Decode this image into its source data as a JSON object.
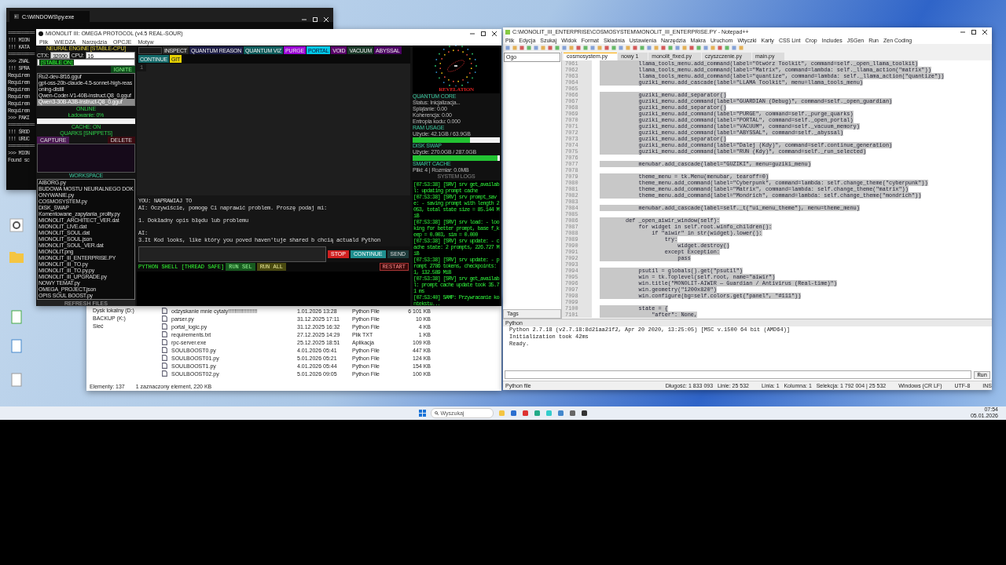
{
  "console": {
    "title": "C:\\WINDOWS\\py.exe",
    "lines": [
      "==========",
      "!!! MION",
      "!!! KATA",
      "==========",
      ">>> ZNAL",
      "!!! SPRA",
      "Requirem",
      "Requirem",
      "Requirem",
      "Requirem",
      "Requirem",
      "Requirem",
      ">>> PAKI",
      "==========",
      "!!! ŚROD",
      "!!! URUC",
      "==========",
      ">>> MION",
      "Found sc"
    ]
  },
  "app": {
    "title": "MIONOLIT III: OMEGA PROTOCOL (v4.5 REAL-SOUR)",
    "menu": [
      "Plik",
      "WIEDZA",
      "Narzędzia",
      "OPCJE",
      "Motyw"
    ],
    "engine": {
      "heading": "NEURAL ENGINE [STABLE-CPU]",
      "ctx_label": "CTX:",
      "ctx_value": "32000",
      "cpu_label": "CPU:",
      "cpu_value": "16",
      "mode_value": "[STABLE ON]",
      "ignite": "IGNITE",
      "models": [
        {
          "name": "Ru2-dev-8f16.gguf",
          "selected": false
        },
        {
          "name": "gpt-oss-20b-claude-4.5-sonnet-high-reasoning-distill",
          "selected": false
        },
        {
          "name": "Qwen-Coder-V1-40B-instruct.Q8_0.gguf",
          "selected": false
        },
        {
          "name": "Qwen3-30B-A3B-Instruct-Q8_0.gguf",
          "selected": true
        }
      ],
      "status": "ONLINE",
      "loading": "Ładowanie: 0%",
      "level": 0,
      "cache": "CACHE: ON"
    },
    "quarks": {
      "heading": "QUARKS [SNIPPETS]",
      "capture": "CAPTURE",
      "delete": "DELETE"
    },
    "workspace": {
      "heading": "WORKSPACE",
      "files": [
        "AIBORG.py",
        "BUDOWA MOSTU NEURALNEGO DOKONYWANIE.py",
        "COSMOSYSTEM.py",
        "DISK_SWAP",
        "Komentowane_zapytania_prolity.py",
        "MIONOLIT_ARCHITECT_VER.dat",
        "MIONOLIT_LIVE.dat",
        "MIONOLIT_SOUL.dat",
        "MIONOLIT_SOUL.json",
        "MIONOLIT_SOUL_VER.dat",
        "MIONOLIT.png",
        "MIONOLIT_III_ENTERPRISE.PY",
        "MIONOLIT_III_TO.py",
        "MIONOLIT_III_TO.py.py",
        "MIONOLIT_III_UPGRADE.py",
        "NOWY TEMAT.py",
        "OMEGA_PROJECT.json",
        "OPIS SOUL BOOST.py"
      ],
      "refresh": "REFRESH FILES"
    },
    "toolbar": [
      {
        "label": "INSPECT",
        "color": "#2b2b2b"
      },
      {
        "label": "QUANTUM REASON",
        "color": "#1e1e46"
      },
      {
        "label": "QUANTUM VIZ",
        "color": "#0f5c5c"
      },
      {
        "label": "PURGE",
        "color": "#9b00d6"
      },
      {
        "label": "PORTAL",
        "color": "#00c8e8"
      },
      {
        "label": "VOID",
        "color": "#5a006a"
      },
      {
        "label": "VACUUM",
        "color": "#1c3a2a"
      },
      {
        "label": "ABYSSAL",
        "color": "#4a0060"
      },
      {
        "label": "CONTINUE",
        "color": "#136a6a"
      },
      {
        "label": "GIT",
        "color": "#e6d200"
      }
    ],
    "editor": {
      "line_number": "1"
    },
    "chat": [
      [
        "YOU: NAPRAWIAJ TO",
        "AI: Oczywiście, pomogę Ci naprawić problem. Proszę podaj mi:"
      ],
      [
        "1. Dokładny opis błędu lub problemu"
      ],
      [
        "AI:",
        "3.It Kod looks, like który you poved haven'tuje shared b chcią actuald Python"
      ]
    ],
    "chat_buttons": {
      "stop": "STOP",
      "continue": "CONTINUE",
      "send": "SEND"
    },
    "shell": {
      "title": "PYTHON SHELL [THREAD SAFE]",
      "run_sel": "RUN SEL",
      "run_all": "RUN ALL",
      "restart": "RESTART"
    },
    "monitor": {
      "title": "REVELATION",
      "core_title": "QUANTUM CORE",
      "core_lines": [
        "Status: Inicjalizacja...",
        "Splątanie: 0.00",
        "Koherencja: 0.00",
        "Entropia kodu: 0.000"
      ],
      "meters": [
        {
          "title": "RAM USAGE",
          "reading": "Użycie: 42.1GB / 63.9GB",
          "level": 0.66
        },
        {
          "title": "DISK SWAP",
          "reading": "Użycie: 270.0GB / 287.0GB",
          "level": 0.97
        }
      ],
      "cache_title": "SMART CACHE",
      "cache_line": "Pliki: 4 | Rozmiar: 0.0MB",
      "logs_title": "SYSTEM LOGS",
      "logs": [
        "[07:53:38] [SRV] srv get_availabl: updating prompt cache",
        "[07:53:38] [SRV] srv prompt_save: - saving prompt with length 2053, total state size = 85.144 MiB",
        "[07:53:38] [SRV] srv load: - looking for better prompt, base f_keep = 0.003, sim = 0.000",
        "[07:53:38] [SRV] srv update: - cache state: 2 prompts, 226.727 MiB",
        "[07:53:38] [SRV] srv update: - prompt 2786 tokens, checkpoints: 1, 132.589 MiB",
        "[07:53:38] [SRV] srv get_availabl: prompt cache update took 35.71 ms",
        "[07:53:40] SAMP: Przywracanie kontekstu..."
      ]
    }
  },
  "explorer": {
    "tree": [
      "Dysk lokalny (D:)",
      "BACKUP (K:)",
      "Sieć"
    ],
    "rows": [
      {
        "name": "odzyskanie mnie cytaty!!!!!!!!!!!!!!!!!!!",
        "date": "1.01.2026 13:28",
        "type": "Python File",
        "size": "6 101 KB"
      },
      {
        "name": "parser.py",
        "date": "31.12.2025 17:11",
        "type": "Python File",
        "size": "10 KB"
      },
      {
        "name": "portal_logic.py",
        "date": "31.12.2025 16:32",
        "type": "Python File",
        "size": "4 KB"
      },
      {
        "name": "requirements.txt",
        "date": "27.12.2025 14:29",
        "type": "Plik TXT",
        "size": "1 KB"
      },
      {
        "name": "rpc-server.exe",
        "date": "25.12.2025 18:51",
        "type": "Aplikacja",
        "size": "109 KB"
      },
      {
        "name": "SOULBOOST0.py",
        "date": "4.01.2026 05:41",
        "type": "Python File",
        "size": "447 KB"
      },
      {
        "name": "SOULBOOST01.py",
        "date": "5.01.2026 05:21",
        "type": "Python File",
        "size": "124 KB"
      },
      {
        "name": "SOULBOOST1.py",
        "date": "4.01.2026 05:44",
        "type": "Python File",
        "size": "154 KB"
      },
      {
        "name": "SOULBOOST02.py",
        "date": "5.01.2026 09:05",
        "type": "Python File",
        "size": "100 KB"
      }
    ],
    "status": [
      "Elementy: 137",
      "1 zaznaczony element, 220 KB"
    ]
  },
  "notepad": {
    "title": "C:\\MONOLIT_III_ENTERPRISE\\COSMOSYSTEM\\MONOLIT_III_ENTERPRISE.PY - Notepad++",
    "menu": [
      "Plik",
      "Edycja",
      "Szukaj",
      "Widok",
      "Format",
      "Składnia",
      "Ustawienia",
      "Narzędzia",
      "Makra",
      "Uruchom",
      "Wtyczki",
      "Karty",
      "CSS Lint",
      "Crop",
      "Includes",
      "JSGen",
      "Run",
      "Zen Coding"
    ],
    "tabs": [
      {
        "label": "cosmosystem.py",
        "selected": true
      },
      {
        "label": "nowy 1",
        "selected": false
      },
      {
        "label": "monolit_fixed.py",
        "selected": false
      },
      {
        "label": "czyszczenie.py",
        "selected": false
      },
      {
        "label": "main.py",
        "selected": false
      }
    ],
    "search_value": "Ogo",
    "code": [
      {
        "n": "7061",
        "text": "            llama_tools_menu.add_command(label=\"Otwórz Toolkit\", command=self._open_llama_toolkit)"
      },
      {
        "n": "7062",
        "text": "            llama_tools_menu.add_command(label=\"Matrix\", command=lambda: self._llama_action(\"matrix\"))"
      },
      {
        "n": "7063",
        "text": "            llama_tools_menu.add_command(label=\"quantize\", command=lambda: self._llama_action(\"quantize\"))"
      },
      {
        "n": "7064",
        "text": "            guziki_menu.add_cascade(label=\"LLAMA Toolkit\", menu=llama_tools_menu)"
      },
      {
        "n": "7065"
      },
      {
        "n": "7066",
        "text": "            guziki_menu.add_separator()"
      },
      {
        "n": "7067",
        "text": "            guziki_menu.add_command(label=\"GUARDIAN (Debug)\", command=self._open_guardian)"
      },
      {
        "n": "7068",
        "text": "            guziki_menu.add_separator()"
      },
      {
        "n": "7069",
        "text": "            guziki_menu.add_command(label=\"PURGE\", command=self._purge_quarks)"
      },
      {
        "n": "7070",
        "text": "            guziki_menu.add_command(label=\"PORTAL\", command=self._open_portal)"
      },
      {
        "n": "7071",
        "text": "            guziki_menu.add_command(label=\"VACUUM\", command=self._vacuum_memory)"
      },
      {
        "n": "7072",
        "text": "            guziki_menu.add_command(label=\"ABYSSAL\", command=self._abyssal)"
      },
      {
        "n": "7073",
        "text": "            guziki_menu.add_separator()"
      },
      {
        "n": "7074",
        "text": "            guziki_menu.add_command(label=\"Dalej (Kdy)\", command=self.continue_generation)"
      },
      {
        "n": "7075",
        "text": "            guziki_menu.add_command(label=\"RUN (Kdy)\", command=self._run_selected)"
      },
      {
        "n": "7076"
      },
      {
        "n": "7077",
        "text": "            menubar.add_cascade(label=\"GUZIKI\", menu=guziki_menu)"
      },
      {
        "n": "7078"
      },
      {
        "n": "7079",
        "text": "            theme_menu = tk.Menu(menubar, tearoff=0)"
      },
      {
        "n": "7080",
        "text": "            theme_menu.add_command(label=\"Cyberpunk\", command=lambda: self.change_theme(\"cyberpunk\"))"
      },
      {
        "n": "7081",
        "text": "            theme_menu.add_command(label=\"Matrix\", command=lambda: self.change_theme(\"matrix\"))"
      },
      {
        "n": "7082",
        "text": "            theme_menu.add_command(label=\"Mondrich\", command=lambda: self.change_theme(\"mondrich\"))"
      },
      {
        "n": "7083"
      },
      {
        "n": "7084",
        "text": "            menubar.add_cascade(label=self._t(\"ui_menu_theme\"), menu=theme_menu)"
      },
      {
        "n": "7085"
      },
      {
        "n": "7086",
        "text": "        def _open_aiwir_window(self):"
      },
      {
        "n": "7087",
        "text": "            for widget in self.root.winfo_children():"
      },
      {
        "n": "7088",
        "text": "                if \"aiwir\" in str(widget).lower():"
      },
      {
        "n": "7089",
        "text": "                    try:"
      },
      {
        "n": "7090",
        "text": "                        widget.destroy()"
      },
      {
        "n": "7091",
        "text": "                    except Exception:"
      },
      {
        "n": "7092",
        "text": "                        pass"
      },
      {
        "n": "7093"
      },
      {
        "n": "7094",
        "text": "            psutil = globals().get(\"psutil\")"
      },
      {
        "n": "7095",
        "text": "            win = tk.Toplevel(self.root, name=\"aiwir\")"
      },
      {
        "n": "7096",
        "text": "            win.title(\"MONOLIT-AIWIR — Guardian / Antivirus (Real-time)\")"
      },
      {
        "n": "7097",
        "text": "            win.geometry(\"1200x820\")"
      },
      {
        "n": "7098",
        "text": "            win.configure(bg=self.colors.get(\"panel\", \"#111\"))"
      },
      {
        "n": "7099"
      },
      {
        "n": "7100",
        "text": "            state = {"
      },
      {
        "n": "7101",
        "text": "                \"after\": None,"
      }
    ],
    "panel_tab": "Tags",
    "console_title": "Python",
    "console_lines": [
      "Python 2.7.18 (v2.7.18:8d21aa21f2, Apr 20 2020, 13:25:05) [MSC v.1500 64 bit (AMD64)]",
      "Initialization took 42ms",
      "Ready."
    ],
    "run_button": "Run",
    "status": [
      "Python file",
      "Długość: 1 833 093   Linie: 25 532",
      "Linia: 1   Kolumna: 1   Selekcja: 1 792 004 | 25 532",
      "Windows (CR LF)",
      "UTF-8",
      "INS"
    ]
  },
  "taskbar": {
    "search_placeholder": "Wyszukaj",
    "time": "07:54",
    "date": "05.01.2026"
  }
}
